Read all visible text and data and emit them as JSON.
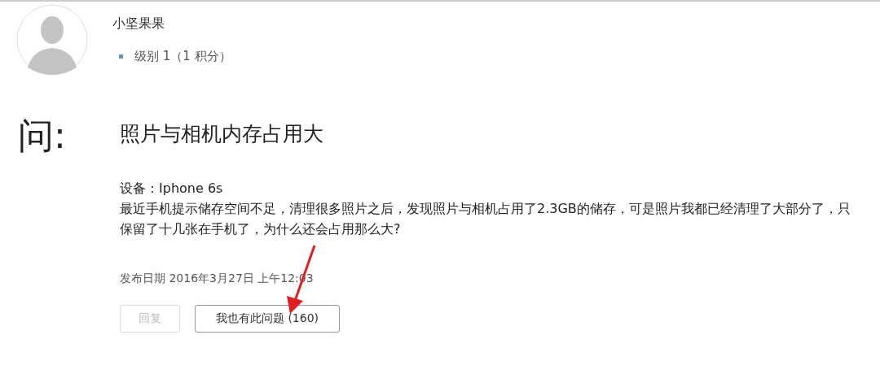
{
  "author": {
    "name": "小坚果果",
    "level": "级别 1（1 积分）"
  },
  "question": {
    "marker": "问:",
    "title": "照片与相机内存占用大",
    "device": "设备：Iphone 6s",
    "body": "最近手机提示储存空间不足，清理很多照片之后，发现照片与相机占用了2.3GB的储存，可是照片我都已经清理了大部分了，只保留了十几张在手机了，为什么还会占用那么大?",
    "date": "发布日期 2016年3月27日 上午12:03"
  },
  "buttons": [
    {
      "label": "回复",
      "disabled": true
    },
    {
      "label": "我也有此问题 (160)",
      "disabled": false
    }
  ]
}
